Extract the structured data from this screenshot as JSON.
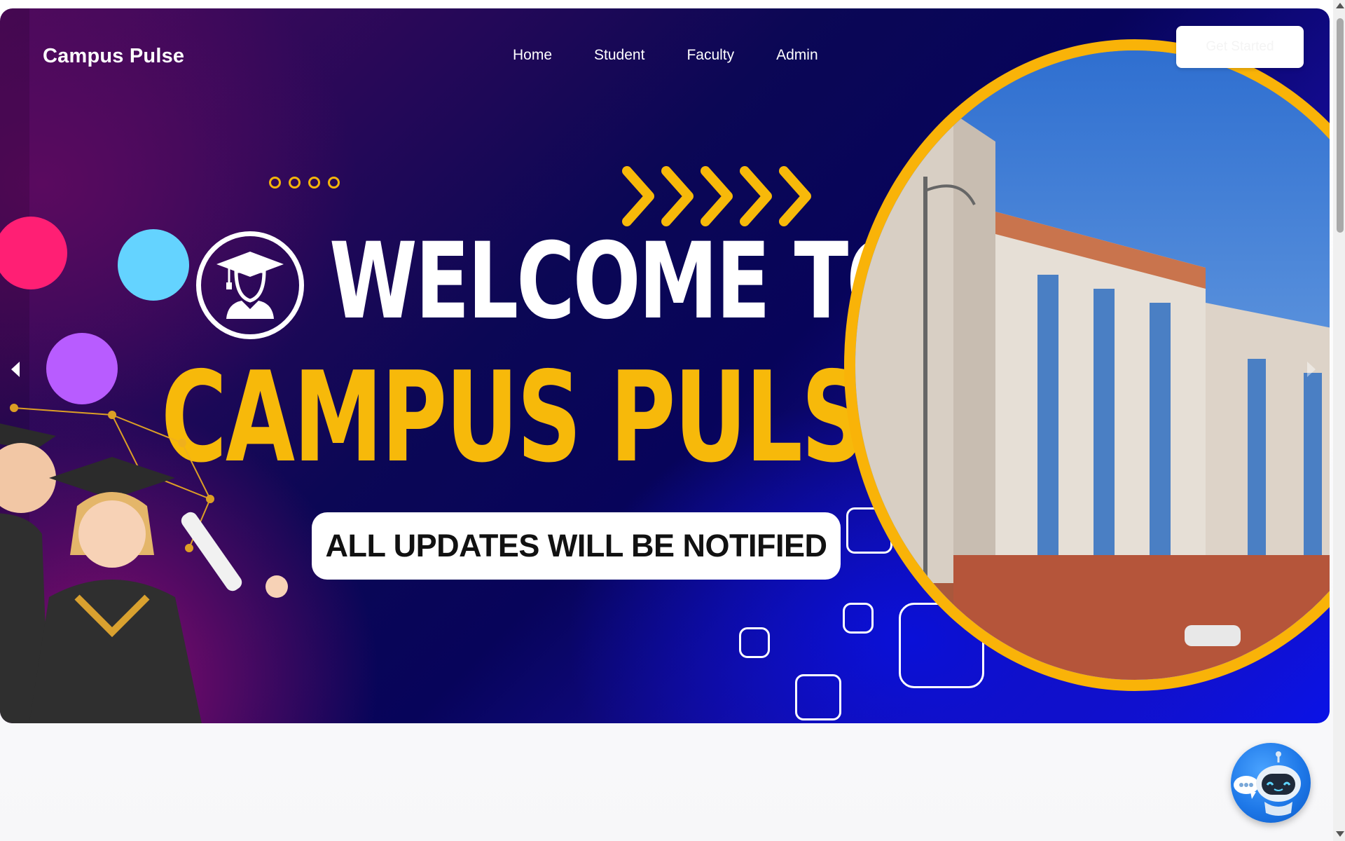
{
  "nav": {
    "brand": "Campus Pulse",
    "links": [
      {
        "label": "Home"
      },
      {
        "label": "Student"
      },
      {
        "label": "Faculty"
      },
      {
        "label": "Admin"
      }
    ],
    "cta_label": "Get Started"
  },
  "hero": {
    "headline_line1": "WELCOME TO",
    "headline_line2": "CAMPUS PULSE",
    "banner_text": "ALL UPDATES WILL BE NOTIFIED",
    "icons": {
      "prev": "chevron-left-icon",
      "next": "chevron-right-icon",
      "badge": "graduate-icon"
    }
  },
  "chatbot": {
    "icon": "robot-icon"
  },
  "colors": {
    "accent_yellow": "#f7b90a",
    "hero_navy": "#07045a",
    "hero_blue": "#0a12e6",
    "hero_magenta": "#8b0d6e",
    "text_white": "#ffffff"
  }
}
